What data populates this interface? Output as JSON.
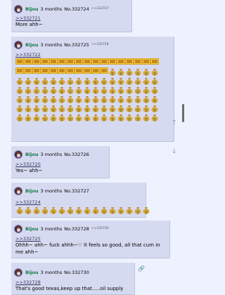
{
  "posts": [
    {
      "name": "Bijou",
      "time": "3 months",
      "no": "No.332724",
      "replies": ">>332727",
      "quote": ">>332721",
      "text": "More ahh~"
    },
    {
      "name": "Bijou",
      "time": "3 months",
      "no": "No.332725",
      "replies": ">>332728",
      "quote": ">>332722",
      "emoji_rows": [
        {
          "type": "flag",
          "count": 17
        },
        {
          "type": "flag-mix",
          "count": 17
        },
        {
          "type": "money",
          "count": 17
        },
        {
          "type": "money",
          "count": 17
        },
        {
          "type": "money",
          "count": 17
        },
        {
          "type": "money",
          "count": 17
        },
        {
          "type": "money",
          "count": 17
        }
      ]
    },
    {
      "name": "Bijou",
      "time": "3 months",
      "no": "No.332726",
      "quote": ">>332720",
      "text": "Yes~ ahh~"
    },
    {
      "name": "Bijou",
      "time": "3 months",
      "no": "No.332727",
      "quote": ">>332724",
      "emoji_count": 16
    },
    {
      "name": "Bijou",
      "time": "3 months",
      "no": "No.332728",
      "replies": ">>332730",
      "quote": ">>332725",
      "text": "Ohhh~ ahh~ fuck ahhh~♡ it feels so good, all that cum in me ahh~"
    },
    {
      "name": "Bijou",
      "time": "3 months",
      "no": "No.332730",
      "quote": ">>332728",
      "text": "That's good texas,keep up that.....oil supply"
    }
  ],
  "icons": {
    "up_arrow": "↑",
    "down_arrow": "↓",
    "link": "🔗"
  }
}
